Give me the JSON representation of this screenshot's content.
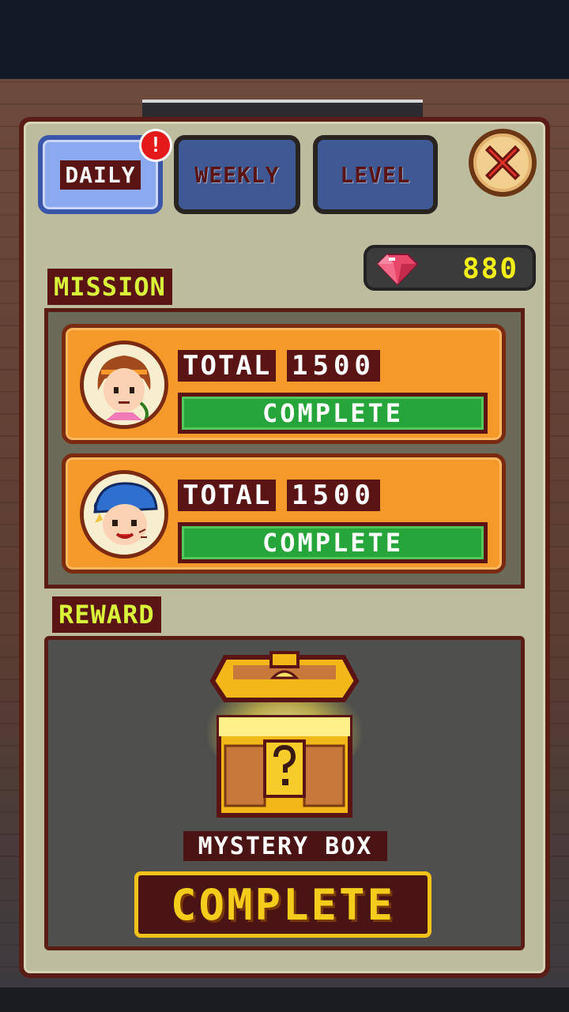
{
  "tabs": [
    {
      "label": "DAILY",
      "state": "active",
      "alert": "!"
    },
    {
      "label": "WEEKLY",
      "state": "inactive"
    },
    {
      "label": "LEVEL",
      "state": "inactive"
    }
  ],
  "close_icon": "close-x-icon",
  "gems": {
    "icon": "gem-icon",
    "count": "880"
  },
  "sections": {
    "mission": "MISSION",
    "reward": "REWARD"
  },
  "missions": [
    {
      "avatar": "girl-avatar-icon",
      "total_label": "TOTAL",
      "total_value": "1500",
      "status": "COMPLETE"
    },
    {
      "avatar": "boy-cap-avatar-icon",
      "total_label": "TOTAL",
      "total_value": "1500",
      "status": "COMPLETE"
    }
  ],
  "reward": {
    "icon": "treasure-chest-icon",
    "name": "MYSTERY BOX",
    "button": "COMPLETE"
  },
  "colors": {
    "panel": "#bdbc9f",
    "border": "#5a1d16",
    "tab_active": "#8aa9ee",
    "tab_inactive": "#3f5994",
    "mission_card": "#f59a2a",
    "complete_green": "#26a53a",
    "label_text": "#d9f23a",
    "gem_count": "#f2ee1a",
    "button_gold": "#f4cc1c"
  }
}
